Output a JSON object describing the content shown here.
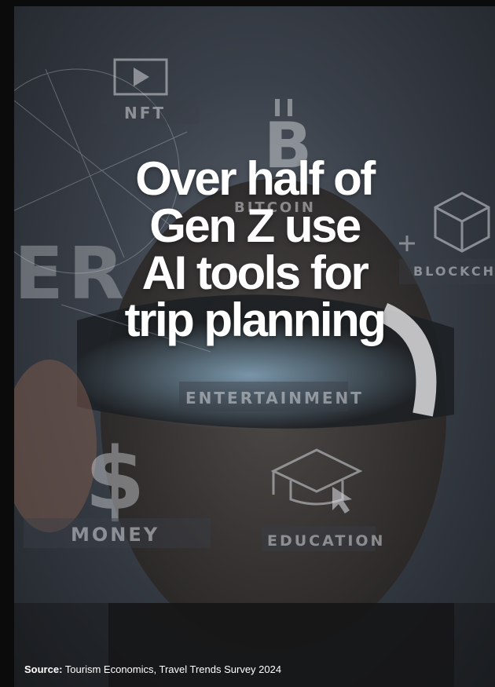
{
  "headline": {
    "lines": [
      "Over half of",
      "Gen Z use",
      "AI tools for",
      "trip planning"
    ],
    "color": "#ffffff"
  },
  "background_labels": {
    "nft": "NFT",
    "bitcoin": "BITCOIN",
    "blockchain": "BLOCKCHA",
    "entertainment": "ENTERTAINMENT",
    "money": "MONEY",
    "education": "EDUCATION",
    "partial_left": "ER"
  },
  "icons": [
    "play-icon",
    "bitcoin-icon",
    "cube-icon",
    "dollar-icon",
    "graduation-cap-icon",
    "cursor-icon",
    "plus-icon"
  ],
  "source": {
    "label": "Source:",
    "text": "Tourism Economics, Travel Trends Survey 2024"
  }
}
